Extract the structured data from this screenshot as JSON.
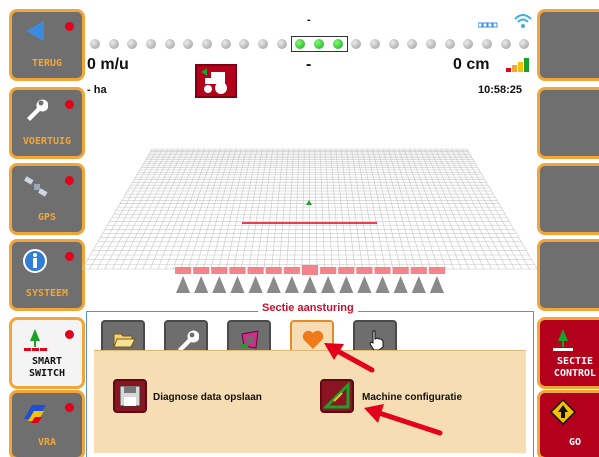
{
  "colors": {
    "accent": "#f2a63a",
    "alert": "#e2001a",
    "active_green": "#1aa12a"
  },
  "left_buttons": [
    {
      "label": "TERUG",
      "icon": "back-arrow-icon"
    },
    {
      "label": "VOERTUIG",
      "icon": "wrench-icon"
    },
    {
      "label": "GPS",
      "icon": "satellite-icon"
    },
    {
      "label": "SYSTEEM",
      "icon": "info-icon"
    },
    {
      "label": "SMART\nSWITCH",
      "icon": "section-switch-icon"
    },
    {
      "label": "VRA",
      "icon": "vra-map-icon"
    }
  ],
  "right_buttons": [
    {
      "label": "SECTIE\nCONTROL",
      "icon": "section-control-icon"
    },
    {
      "label": "GO",
      "icon": "go-arrow-icon"
    }
  ],
  "status": {
    "top_marker": "-",
    "speed": "0 m/u",
    "center_value": "-",
    "offset": "0 cm",
    "area": "- ha",
    "clock": "10:58:25",
    "active_indicator_count": 3,
    "indicator_total": 24
  },
  "panel": {
    "title": "Sectie aansturing",
    "tabs": [
      {
        "icon": "folder-open-icon",
        "active": false
      },
      {
        "icon": "wrench-icon",
        "active": false
      },
      {
        "icon": "boundary-icon",
        "active": false
      },
      {
        "icon": "heart-icon",
        "active": true
      },
      {
        "icon": "hand-pointer-icon",
        "active": false
      }
    ],
    "actions": [
      {
        "label": "Diagnose data opslaan",
        "icon": "save-disk-icon"
      },
      {
        "label": "Machine configuratie",
        "icon": "machine-config-icon"
      }
    ]
  }
}
